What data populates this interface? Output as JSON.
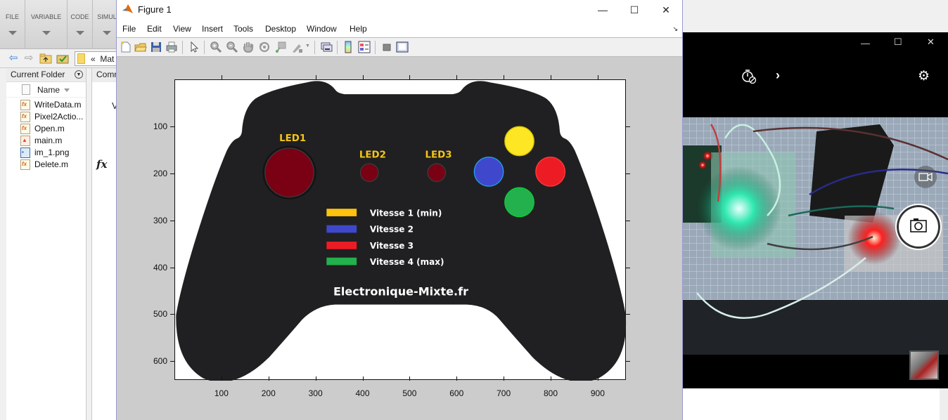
{
  "matlab": {
    "ribbon_tabs": [
      "FILE",
      "VARIABLE",
      "CODE",
      "SIMUL"
    ],
    "path_prefix": "«",
    "path_text": "Mat",
    "current_folder": {
      "title": "Current Folder",
      "column_header": "Name",
      "files": [
        {
          "name": "WriteData.m",
          "type": "function"
        },
        {
          "name": "Pixel2Actio...",
          "type": "function"
        },
        {
          "name": "Open.m",
          "type": "function"
        },
        {
          "name": "main.m",
          "type": "script"
        },
        {
          "name": "im_1.png",
          "type": "image"
        },
        {
          "name": "Delete.m",
          "type": "function"
        }
      ]
    },
    "command_window": {
      "title": "Comm",
      "text": "V",
      "fx_symbol": "fx"
    }
  },
  "figure": {
    "title": "Figure 1",
    "window_controls": {
      "minimize": "—",
      "maximize": "☐",
      "close": "✕"
    },
    "menu": [
      "File",
      "Edit",
      "View",
      "Insert",
      "Tools",
      "Desktop",
      "Window",
      "Help"
    ],
    "toolbar": [
      "new-figure",
      "open-file",
      "save",
      "print",
      "edit-plot",
      "zoom-in",
      "zoom-out",
      "pan",
      "rotate-3d",
      "data-cursor",
      "brush",
      "link-plot",
      "insert-colorbar",
      "insert-legend",
      "hide-plot-tools",
      "show-plot-tools"
    ],
    "axes": {
      "x_ticks": [
        100,
        200,
        300,
        400,
        500,
        600,
        700,
        800,
        900
      ],
      "y_ticks": [
        100,
        200,
        300,
        400,
        500,
        600
      ],
      "x_range": [
        0,
        960
      ],
      "y_range": [
        0,
        640
      ]
    },
    "image": {
      "led_labels": [
        "LED1",
        "LED2",
        "LED3"
      ],
      "led_colors": {
        "off": "#7a0014",
        "label": "#f5c518"
      },
      "buttons": [
        {
          "name": "yellow",
          "color": "#fde725"
        },
        {
          "name": "blue",
          "color": "#3f48cc"
        },
        {
          "name": "red",
          "color": "#ed1c24"
        },
        {
          "name": "green",
          "color": "#22b14c"
        }
      ],
      "legend": [
        {
          "label": "Vitesse 1 (min)",
          "color": "#ffc20e"
        },
        {
          "label": "Vitesse 2",
          "color": "#3f48cc"
        },
        {
          "label": "Vitesse 3",
          "color": "#ed1c24"
        },
        {
          "label": "Vitesse 4 (max)",
          "color": "#22b14c"
        }
      ],
      "brand": "Electronique-Mixte.fr",
      "controller_color": "#202022"
    }
  },
  "camera": {
    "window_controls": {
      "minimize": "—",
      "maximize": "☐",
      "close": "✕"
    },
    "timer_icon": "timer-off",
    "expand_icon": "›",
    "settings_icon": "⚙",
    "video_mode_icon": "video-camera",
    "shutter_icon": "camera"
  }
}
